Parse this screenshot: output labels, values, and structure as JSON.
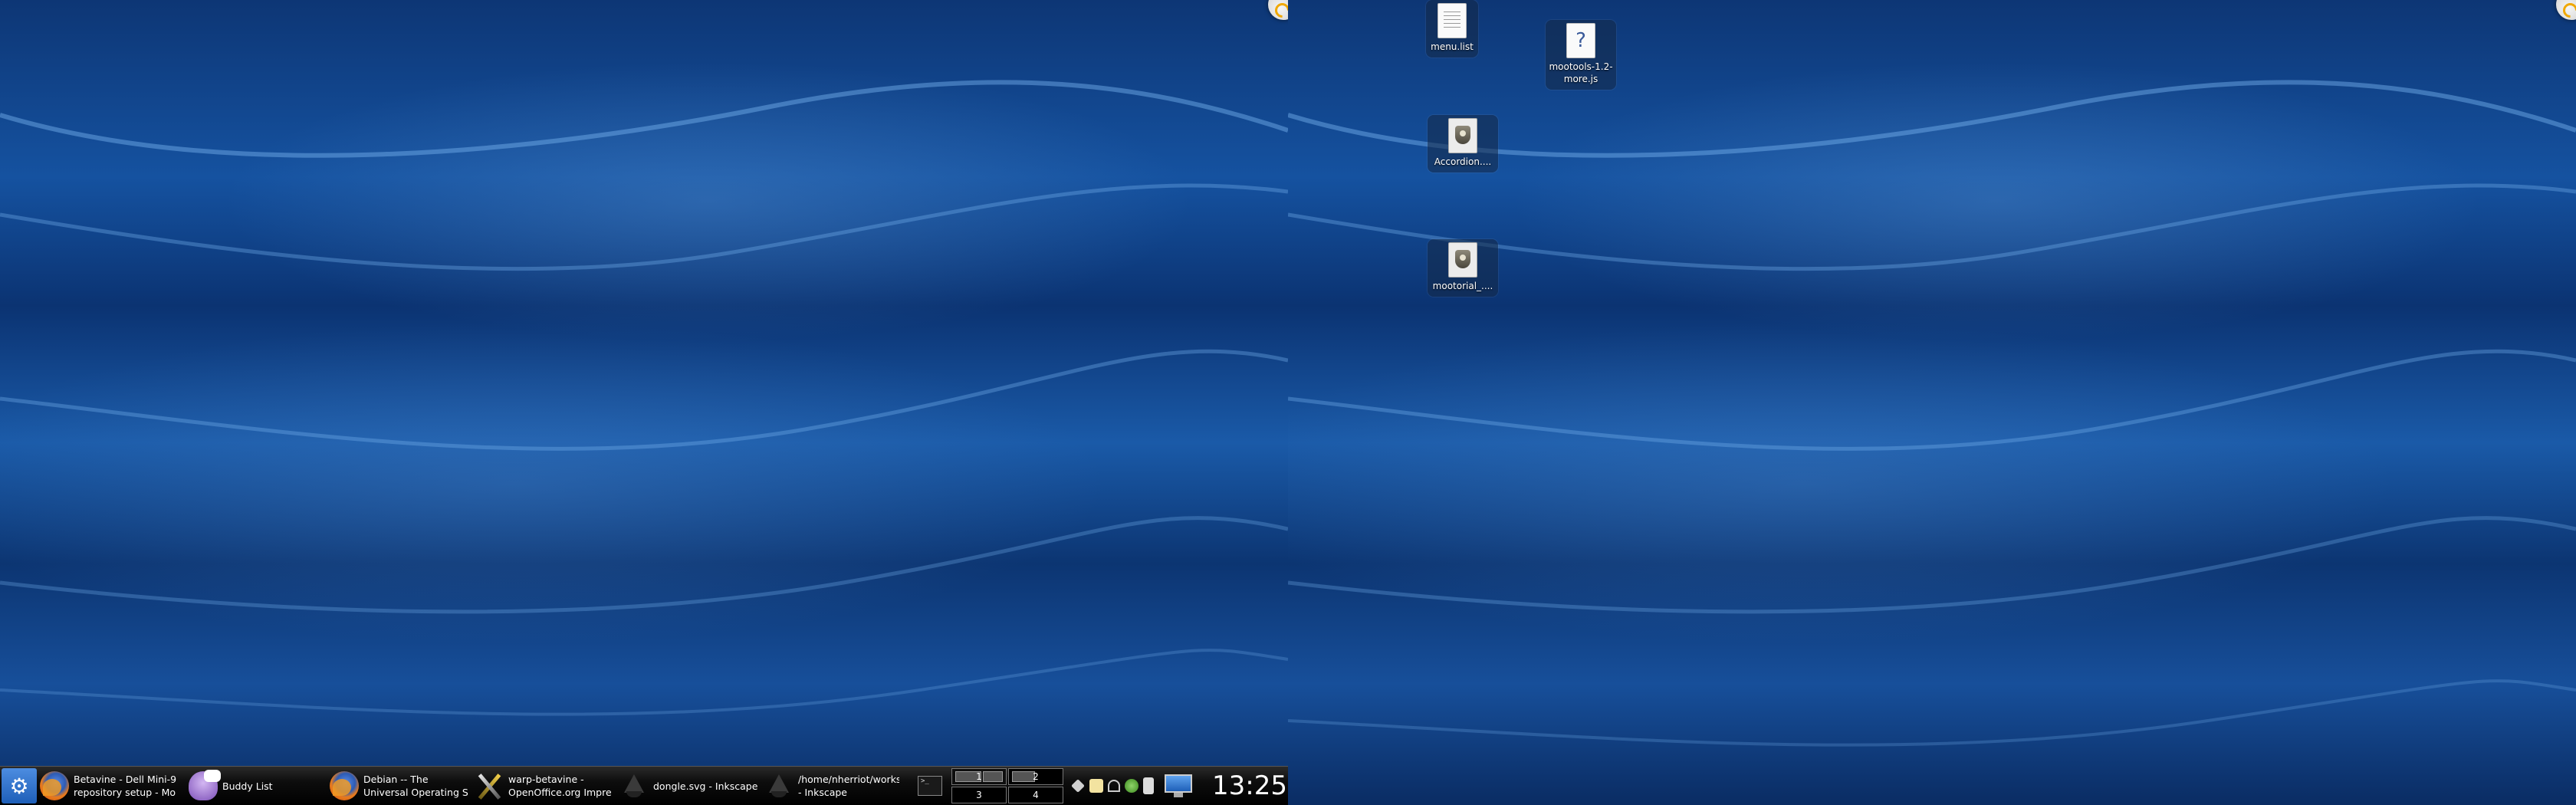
{
  "desktop": {
    "icons": [
      {
        "label": "menu.list",
        "icon": "text-document-icon"
      },
      {
        "label": "mootools-1.2-more.js",
        "label_line1": "mootools-1.2-",
        "label_line2": "more.js",
        "icon": "unknown-file-icon"
      },
      {
        "label": "Accordion....",
        "icon": "html-document-icon"
      },
      {
        "label": "mootorial_....",
        "icon": "html-document-icon"
      }
    ]
  },
  "taskbar": {
    "start_icon": "kde-logo-icon",
    "tasks": [
      {
        "line1": "Betavine - Dell Mini-9",
        "line2": "repository setup - Mo",
        "icon": "firefox-icon"
      },
      {
        "line1": "Buddy List",
        "line2": "",
        "icon": "pidgin-icon"
      },
      {
        "line1": "Debian -- The",
        "line2": "Universal Operating S",
        "icon": "firefox-icon"
      },
      {
        "line1": "warp-betavine -",
        "line2": "OpenOffice.org Impre",
        "icon": "openoffice-icon"
      },
      {
        "line1": "dongle.svg - Inkscape",
        "line2": "",
        "icon": "inkscape-icon"
      },
      {
        "line1": "/home/nherriot/works",
        "line2": "- Inkscape",
        "icon": "inkscape-icon"
      }
    ],
    "terminal_prompt": ">_",
    "pager": [
      "1",
      "2",
      "3",
      "4"
    ],
    "clock": "13:25"
  },
  "colors": {
    "wallpaper_dark": "#0a2d63",
    "wallpaper_light": "#1a5aa8",
    "taskbar": "#000000",
    "text": "#ffffff"
  }
}
